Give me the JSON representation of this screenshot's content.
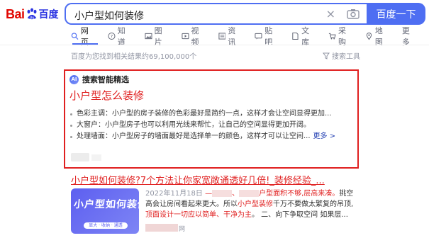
{
  "logo": {
    "part1": "Bai",
    "part2": "百度"
  },
  "search": {
    "query": "小户型如何装修",
    "submit_label": "百度一下",
    "clear_glyph": "×"
  },
  "tabs": [
    {
      "label": "网页",
      "icon": "search-icon",
      "active": true
    },
    {
      "label": "知道",
      "icon": "question-icon"
    },
    {
      "label": "图片",
      "icon": "image-icon"
    },
    {
      "label": "视频",
      "icon": "video-icon"
    },
    {
      "label": "资讯",
      "icon": "news-icon"
    },
    {
      "label": "贴吧",
      "icon": "forum-icon"
    },
    {
      "label": "文库",
      "icon": "doc-icon"
    },
    {
      "label": "采购",
      "icon": "cart-icon"
    },
    {
      "label": "地图",
      "icon": "map-icon"
    },
    {
      "label": "更多",
      "icon": ""
    }
  ],
  "result_info": "百度为您找到相关结果约69,100,000个",
  "tools_label": "搜索工具",
  "ai_card": {
    "badge": "AI",
    "header": "搜索智能精选",
    "question": "小户型怎么装修",
    "items": [
      "色彩主调：小户型的房子装修的色彩最好是简约一点，这样才会让空间显得更加...",
      "大窗户：小户型房子也可以利用光线来帮忙，让自己的空间显得更加开阔。",
      "处理墙面：小户型房子的墙面最好是选择单一的颜色，这样才可以让空间..."
    ],
    "more_label": "更多 >"
  },
  "result2": {
    "title_a": "小户型如何装修",
    "title_b": "?7个方法让你家宽敞通透好几倍!_装修经验_...",
    "thumb_title": "小户型如何装修",
    "thumb_sub": "显大 · 收纳 · 通透",
    "date": "2022年11月18日",
    "dash": "—",
    "seg1": "、",
    "hl1": "户型面积不够,层高来凑。",
    "seg2": "挑空高会让房间看起来更大。所以",
    "hl2": "小户型装修",
    "seg3": "千万不要做太繁复的吊顶,",
    "hl3": "顶面设计一切应以简单、干净为主",
    "seg4": "。 二、向下争取空间 如果层...",
    "source_suffix": "网"
  },
  "colors": {
    "accent": "#4e6ef2",
    "red": "#e02020",
    "link": "#2440b3"
  }
}
